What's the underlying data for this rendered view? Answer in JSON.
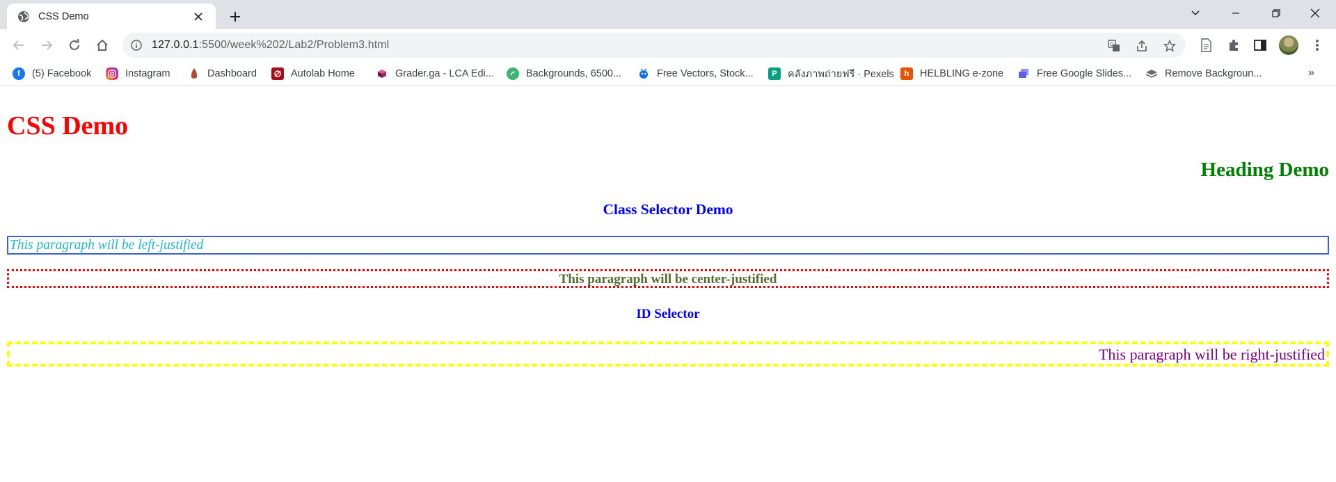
{
  "browser": {
    "tab": {
      "title": "CSS Demo"
    },
    "url": {
      "host": "127.0.0.1",
      "path": ":5500/week%202/Lab2/Problem3.html"
    },
    "bookmarks": [
      {
        "label": "(5) Facebook",
        "icon": "facebook-icon",
        "color": "#1877f2"
      },
      {
        "label": "Instagram",
        "icon": "instagram-icon",
        "color": "#e1306c"
      },
      {
        "label": "Dashboard",
        "icon": "dashboard-icon",
        "color": "#b5483b"
      },
      {
        "label": "Autolab Home",
        "icon": "autolab-icon",
        "color": "#a50f16"
      },
      {
        "label": "Grader.ga - LCA Edi...",
        "icon": "grader-icon",
        "color": "#9b2a6a"
      },
      {
        "label": "Backgrounds, 6500...",
        "icon": "backgrounds-icon",
        "color": "#3cb371"
      },
      {
        "label": "Free Vectors, Stock...",
        "icon": "freepik-icon",
        "color": "#1273eb"
      },
      {
        "label": "คลังภาพถ่ายฟรี · Pexels",
        "icon": "pexels-icon",
        "color": "#05a081"
      },
      {
        "label": "HELBLING e-zone",
        "icon": "helbling-icon",
        "color": "#e35205"
      },
      {
        "label": "Free Google Slides...",
        "icon": "slides-icon",
        "color": "#5b5fe0"
      },
      {
        "label": "Remove Backgroun...",
        "icon": "removebg-icon",
        "color": "#555555"
      }
    ],
    "more_label": "»"
  },
  "page": {
    "h1": "CSS Demo",
    "h2": "Heading Demo",
    "class_heading": "Class Selector Demo",
    "p_left": "This paragraph will be left-justified",
    "p_center": "This paragraph will be center-justified",
    "id_heading": "ID Selector",
    "p_right": "This paragraph will be right-justified"
  }
}
